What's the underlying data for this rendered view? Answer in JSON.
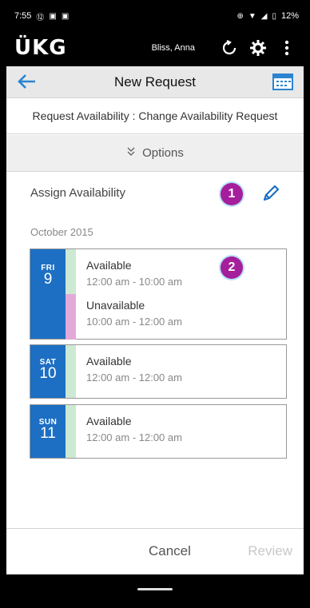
{
  "status_bar": {
    "time": "7:55",
    "left_icons": [
      "⑫",
      "▣",
      "▣"
    ],
    "battery": "12%"
  },
  "app_header": {
    "logo": "ÜKG",
    "user_name": "Bliss, Anna"
  },
  "title_bar": {
    "title": "New Request"
  },
  "subtitle": "Request Availability : Change Availability Request",
  "options": {
    "label": "Options"
  },
  "section": {
    "title": "Assign Availability",
    "badge_1": "1",
    "badge_2": "2"
  },
  "month": "October 2015",
  "days": [
    {
      "dow": "FRI",
      "dom": "9",
      "entries": [
        {
          "status": "Available",
          "time": "12:00 am - 10:00 am"
        },
        {
          "status": "Unavailable",
          "time": "10:00 am - 12:00 am"
        }
      ]
    },
    {
      "dow": "SAT",
      "dom": "10",
      "entries": [
        {
          "status": "Available",
          "time": "12:00 am - 12:00 am"
        }
      ]
    },
    {
      "dow": "SUN",
      "dom": "11",
      "entries": [
        {
          "status": "Available",
          "time": "12:00 am - 12:00 am"
        }
      ]
    }
  ],
  "footer": {
    "cancel": "Cancel",
    "review": "Review"
  },
  "colors": {
    "accent_blue": "#1d6fc4",
    "available_strip": "#cde9d3",
    "unavailable_strip": "#e3a9d8",
    "badge": "#a51e9c"
  }
}
